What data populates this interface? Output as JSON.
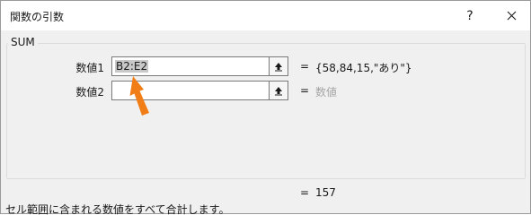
{
  "window": {
    "title": "関数の引数",
    "help_label": "?",
    "close_icon": "close-icon"
  },
  "function": {
    "name": "SUM",
    "result_equals": "=",
    "result_value": "157",
    "description": "セル範囲に含まれる数値をすべて合計します。"
  },
  "arguments": [
    {
      "label": "数値1",
      "value": "B2:E2",
      "equals": "=",
      "result": "{58,84,15,\"あり\"}",
      "button_icon": "collapse-dialog-icon"
    },
    {
      "label": "数値2",
      "value": "",
      "equals": "=",
      "result": "数値",
      "button_icon": "collapse-dialog-icon"
    }
  ],
  "annotation": {
    "arrow_icon": "orange-arrow-icon",
    "arrow_color": "#f07d16"
  }
}
